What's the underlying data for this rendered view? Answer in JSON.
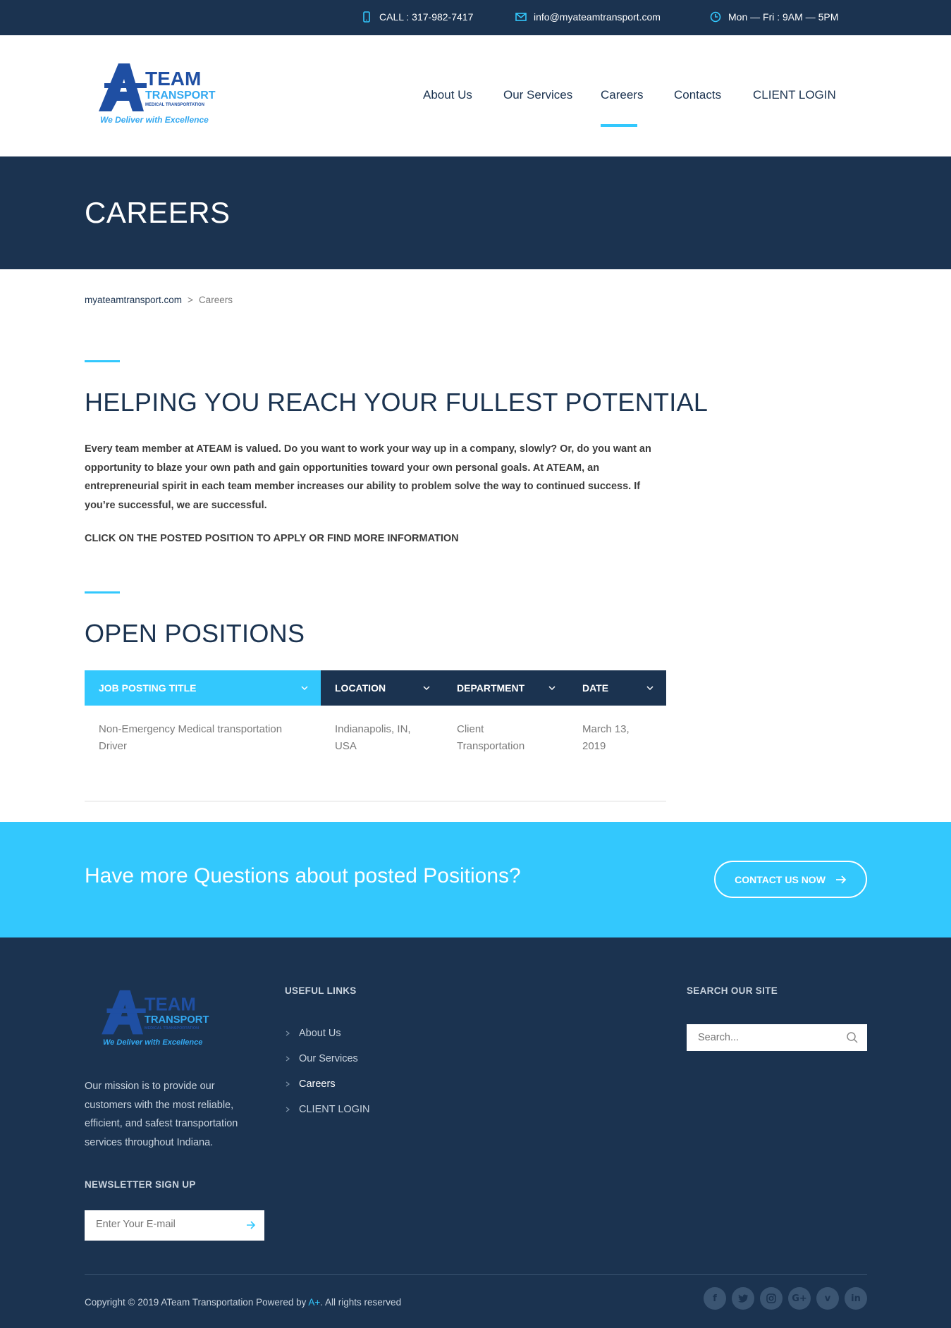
{
  "topbar": {
    "phone": "CALL : 317-982-7417",
    "email": "info@myateamtransport.com",
    "hours": "Mon — Fri : 9AM — 5PM"
  },
  "logo": {
    "word1": "A",
    "word2": "TEAM",
    "word3": "TRANSPORT",
    "sub": "MEDICAL TRANSPORTATION",
    "tagline": "We Deliver with Excellence"
  },
  "nav": {
    "items": [
      "About Us",
      "Our Services",
      "Careers",
      "Contacts",
      "CLIENT LOGIN"
    ],
    "active": "Careers"
  },
  "page": {
    "title": "CAREERS"
  },
  "breadcrumb": {
    "home": "myateamtransport.com",
    "separator": ">",
    "current": "Careers"
  },
  "intro": {
    "heading": "HELPING YOU REACH YOUR FULLEST POTENTIAL",
    "body": "Every team member at ATEAM is valued. Do you want to work your way up in a company, slowly? Or, do you want an opportunity to blaze your own path and gain opportunities toward your own personal goals. At ATEAM, an entrepreneurial spirit in each team member increases our ability to problem solve the way to continued success. If you’re successful, we are successful.",
    "note": "CLICK ON THE POSTED POSITION TO APPLY OR FIND MORE INFORMATION"
  },
  "positions": {
    "heading": "OPEN POSITIONS",
    "columns": [
      "JOB POSTING TITLE",
      "LOCATION",
      "DEPARTMENT",
      "DATE"
    ],
    "rows": [
      [
        "Non-Emergency Medical transportation Driver",
        "Indianapolis, IN, USA",
        "Client Transportation",
        "March 13, 2019"
      ]
    ]
  },
  "cta": {
    "question": "Have more Questions about posted Positions?",
    "button": "CONTACT US NOW"
  },
  "footer": {
    "mission": "Our mission is to provide our customers with the most reliable, efficient, and safest transportation services throughout Indiana.",
    "newsletter_heading": "NEWSLETTER SIGN UP",
    "newsletter_placeholder": "Enter Your E-mail",
    "links_heading": "USEFUL LINKS",
    "links": [
      "About Us",
      "Our Services",
      "Careers",
      "CLIENT LOGIN"
    ],
    "search_heading": "SEARCH OUR SITE",
    "search_placeholder": "Search...",
    "copyright_prefix": "Copyright © 2019 ATeam Transportation Powered by ",
    "copyright_brand": "A+",
    "copyright_suffix": ". All rights reserved",
    "socials": [
      "facebook-icon",
      "twitter-icon",
      "instagram-icon",
      "google-plus-icon",
      "vimeo-icon",
      "linkedin-icon"
    ]
  },
  "colors": {
    "navy": "#1b3350",
    "accent": "#33c8fd",
    "logo_blue": "#1f4fa3"
  }
}
